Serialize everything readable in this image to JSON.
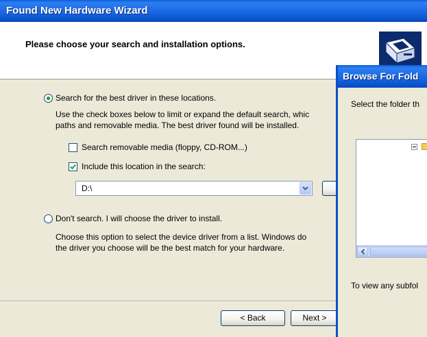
{
  "wizard": {
    "title": "Found New Hardware Wizard",
    "header_title": "Please choose your search and installation options.",
    "icon": "hardware-wizard-icon",
    "option_search": {
      "label": "Search for the best driver in these locations.",
      "selected": true,
      "description_line1": "Use the check boxes below to limit or expand the default search, whic",
      "description_line2": "paths and removable media. The best driver found will be installed."
    },
    "check_removable": {
      "label": "Search removable media (floppy, CD-ROM...)",
      "checked": false
    },
    "check_include": {
      "label": "Include this location in the search:",
      "checked": true
    },
    "location_value": "D:\\",
    "option_dont_search": {
      "label": "Don't search. I will choose the driver to install.",
      "selected": false,
      "description_line1": "Choose this option to select the device driver from a list.  Windows do",
      "description_line2": "the driver you choose will be the best match for your hardware."
    },
    "back_label": "< Back",
    "next_label": "Next >"
  },
  "browse_dialog": {
    "title": "Browse For Fold",
    "prompt": "Select the folder th",
    "hint": "To view any subfol"
  },
  "colors": {
    "title_bar": "#0b5ad6",
    "dialog_bg": "#ece9d8",
    "radio_dot": "#21a121"
  }
}
